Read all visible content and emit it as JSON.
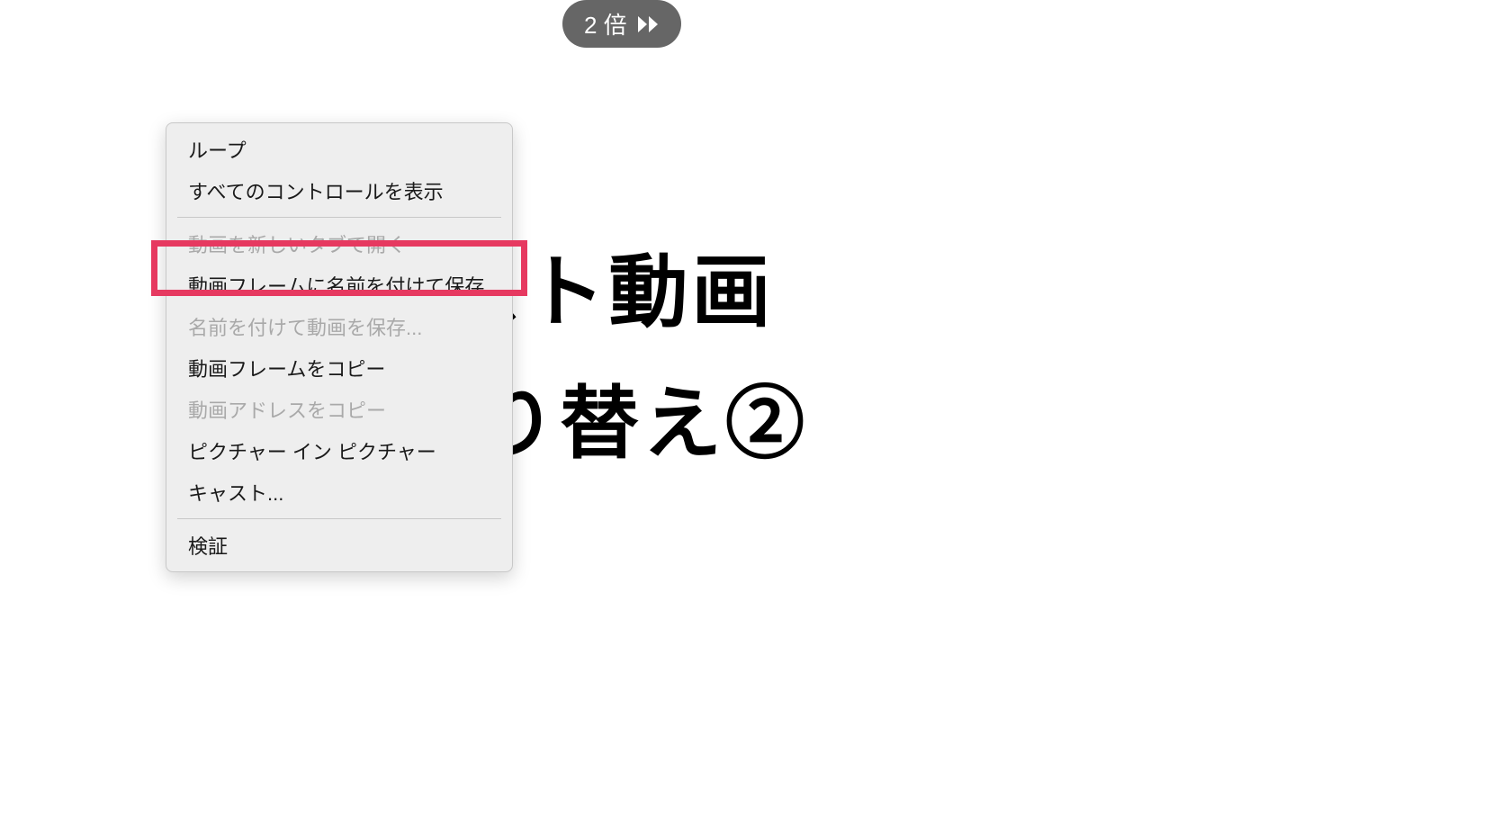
{
  "speedControl": {
    "label": "2 倍"
  },
  "videoContent": {
    "line1": "る テスト動画",
    "line2": "り替え②"
  },
  "contextMenu": {
    "items": [
      {
        "label": "ループ",
        "disabled": false
      },
      {
        "label": "すべてのコントロールを表示",
        "disabled": false
      }
    ],
    "group2": [
      {
        "label": "動画を新しいタブで開く",
        "disabled": true
      },
      {
        "label": "動画フレームに名前を付けて保存...",
        "disabled": false
      },
      {
        "label": "名前を付けて動画を保存...",
        "disabled": true
      },
      {
        "label": "動画フレームをコピー",
        "disabled": false
      },
      {
        "label": "動画アドレスをコピー",
        "disabled": true
      },
      {
        "label": "ピクチャー イン ピクチャー",
        "disabled": false
      },
      {
        "label": "キャスト...",
        "disabled": false
      }
    ],
    "group3": [
      {
        "label": "検証",
        "disabled": false
      }
    ]
  }
}
